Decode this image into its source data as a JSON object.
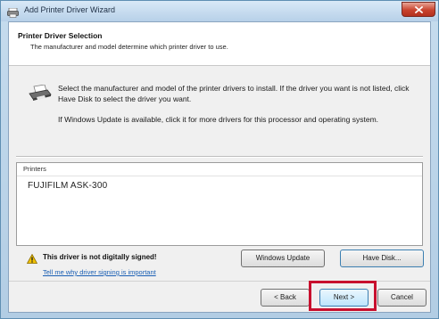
{
  "window": {
    "title": "Add Printer Driver Wizard",
    "icon": "printer-wizard-icon",
    "close_icon": "close-icon"
  },
  "header": {
    "title": "Printer Driver Selection",
    "subtitle": "The manufacturer and model determine which printer driver to use."
  },
  "instructions": {
    "line1": "Select the manufacturer and model of the printer drivers to install. If the driver you want is not listed, click Have Disk to select the driver you want.",
    "line2": "If Windows Update is available, click it for more drivers for this processor and operating system.",
    "icon": "printer-icon"
  },
  "printers": {
    "header_label": "Printers",
    "items": [
      "FUJIFILM ASK-300"
    ]
  },
  "warning": {
    "text": "This driver is not digitally signed!",
    "link": "Tell me why driver signing is important",
    "icon": "warning-icon"
  },
  "buttons": {
    "windows_update": "Windows Update",
    "have_disk": "Have Disk...",
    "back": "< Back",
    "next": "Next >",
    "cancel": "Cancel"
  },
  "colors": {
    "highlight": "#c8102e",
    "link": "#1a5fb4",
    "title_bar": "#b7d0e8"
  }
}
